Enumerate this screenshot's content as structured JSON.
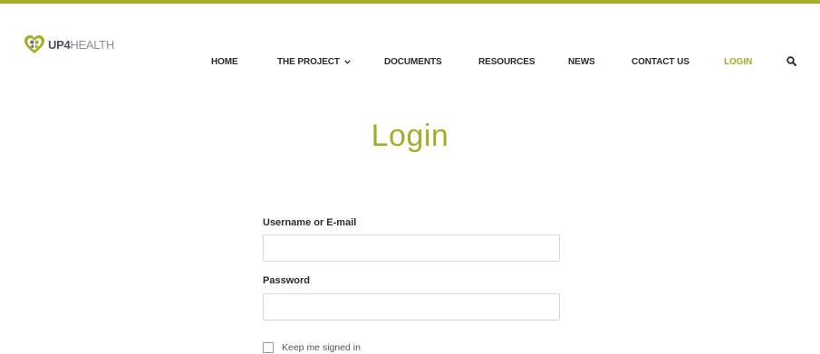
{
  "brand": {
    "logo_strong": "UP4",
    "logo_soft": "HEALTH",
    "accent_color": "#a3ad2d"
  },
  "nav": {
    "home": "HOME",
    "project": "THE PROJECT",
    "documents": "DOCUMENTS",
    "resources": "RESOURCES",
    "news": "NEWS",
    "contact": "CONTACT US",
    "login": "LOGIN",
    "active_item": "LOGIN",
    "search_icon": "search-icon",
    "dropdown_icon": "chevron-down-icon"
  },
  "page": {
    "title": "Login"
  },
  "form": {
    "username_label": "Username or E-mail",
    "username_value": "",
    "password_label": "Password",
    "password_value": "",
    "remember_label": "Keep me signed in",
    "remember_checked": false
  }
}
